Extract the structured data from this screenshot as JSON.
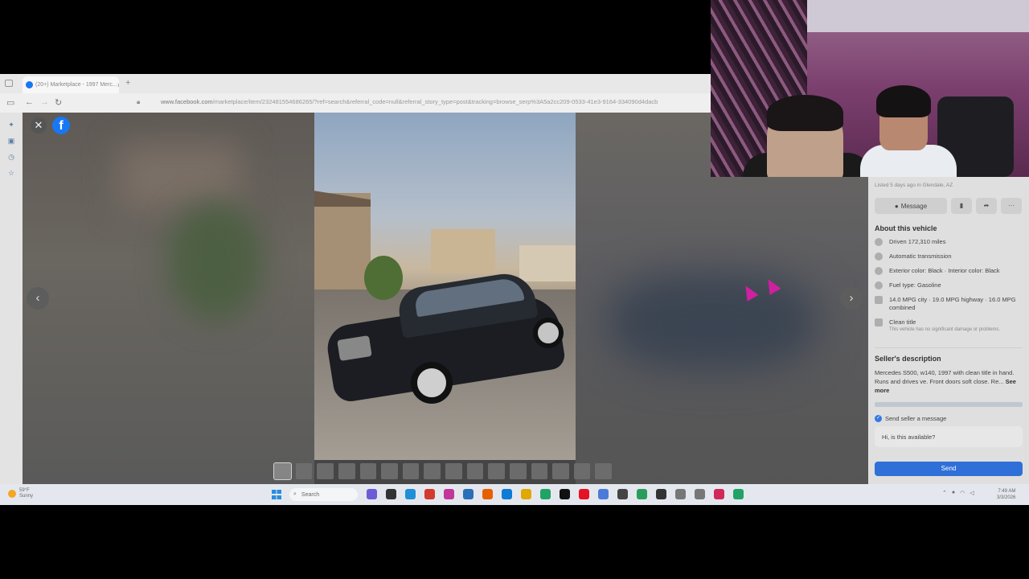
{
  "browser": {
    "tab_title": "(20+) Marketplace - 1997 Merc...",
    "tab_close": "×",
    "new_tab": "+",
    "url_domain": "www.facebook.com",
    "url_path": "/marketplace/item/232481554686265​/?ref=search&referral_code=null&referral_story_type=post&tracking=browse_serp%3A5a2cc209-0533-41e3-9164-334090d4dacb"
  },
  "viewer": {
    "close": "✕",
    "logo": "f",
    "prev": "‹",
    "next": "›",
    "thumb_count": 16
  },
  "listing": {
    "listed": "Listed 5 days ago in Glendale, AZ",
    "message_label": "Message",
    "about_title": "About this vehicle",
    "details": [
      {
        "text": "Driven 172,310 miles",
        "icon": "speedometer-icon",
        "sub": ""
      },
      {
        "text": "Automatic transmission",
        "icon": "transmission-icon",
        "sub": ""
      },
      {
        "text": "Exterior color: Black · Interior color: Black",
        "icon": "paint-icon",
        "sub": ""
      },
      {
        "text": "Fuel type: Gasoline",
        "icon": "fuel-icon",
        "sub": ""
      },
      {
        "text": "14.0 MPG city · 19.0 MPG highway · 16.0 MPG combined",
        "icon": "gas-pump-icon",
        "sub": ""
      },
      {
        "text": "Clean title",
        "icon": "document-icon",
        "sub": "This vehicle has no significant damage or problems."
      }
    ],
    "desc_title": "Seller's description",
    "desc_text": "Mercedes S500, w140, 1997 with  clean title in hand. Runs and drives ve. Front doors soft close. Re...",
    "see_more": "See more",
    "send_check_label": "Send seller a message",
    "message_value": "Hi, is this available?",
    "send_label": "Send"
  },
  "taskbar": {
    "temp": "59°F",
    "condition": "Sunny",
    "search_label": "Search",
    "time": "7:49 AM",
    "date": "3/3/2026",
    "app_colors": [
      "#6b5bd6",
      "#333333",
      "#1f8fd6",
      "#d23b2e",
      "#c2369b",
      "#2a6fb8",
      "#e66000",
      "#0f7bd4",
      "#e0a800",
      "#21a366",
      "#111111",
      "#e81123",
      "#4a7bd8",
      "#444444",
      "#2a9d5c",
      "#333333",
      "#777777",
      "#777777",
      "#d1285c",
      "#21a366"
    ]
  }
}
